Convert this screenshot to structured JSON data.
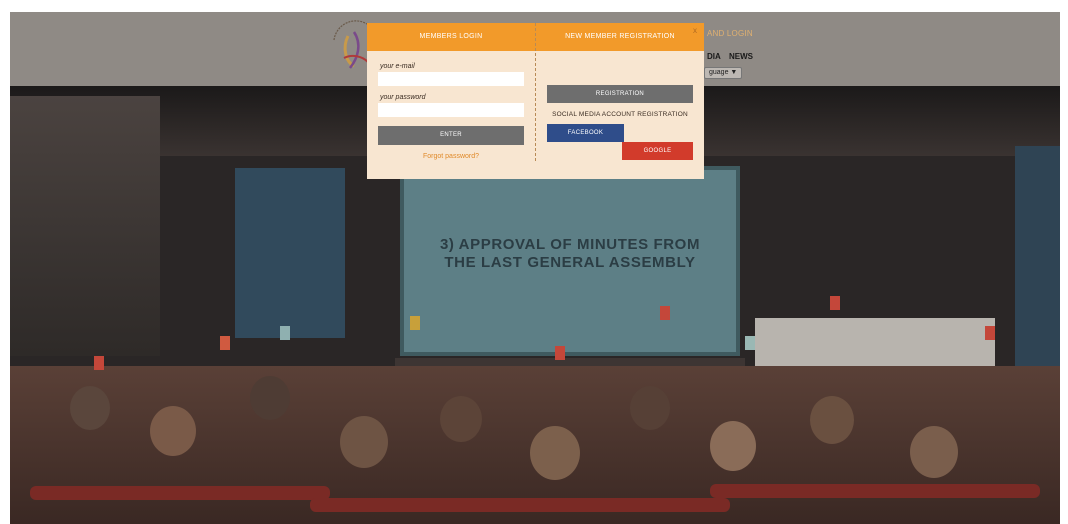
{
  "header": {
    "login_link": "AND LOGIN",
    "nav": [
      "DIA",
      "NEWS"
    ],
    "language_select": "guage ▼"
  },
  "hero": {
    "screen_text_line1": "3) APPROVAL OF MINUTES FROM",
    "screen_text_line2": "THE LAST GENERAL ASSEMBLY"
  },
  "modal": {
    "tab_login": "MEMBERS LOGIN",
    "tab_register": "NEW MEMBER REGISTRATION",
    "close": "x",
    "email_label": "your e-mail",
    "email_value": "",
    "password_label": "your password",
    "password_value": "",
    "enter_button": "ENTER",
    "forgot_link": "Forgot password?",
    "registration_button": "REGISTRATION",
    "social_label": "SOCIAL MEDIA ACCOUNT REGISTRATION",
    "facebook_button": "FACEBOOK",
    "google_button": "GOOGLE"
  },
  "colors": {
    "accent": "#f29a2a",
    "modal_bg": "#f8e6d1",
    "facebook": "#2f4d8a",
    "google": "#d23b2b",
    "button_gray": "#6e6e6e"
  },
  "icons": {
    "search": "search-icon",
    "logo": "logo"
  }
}
